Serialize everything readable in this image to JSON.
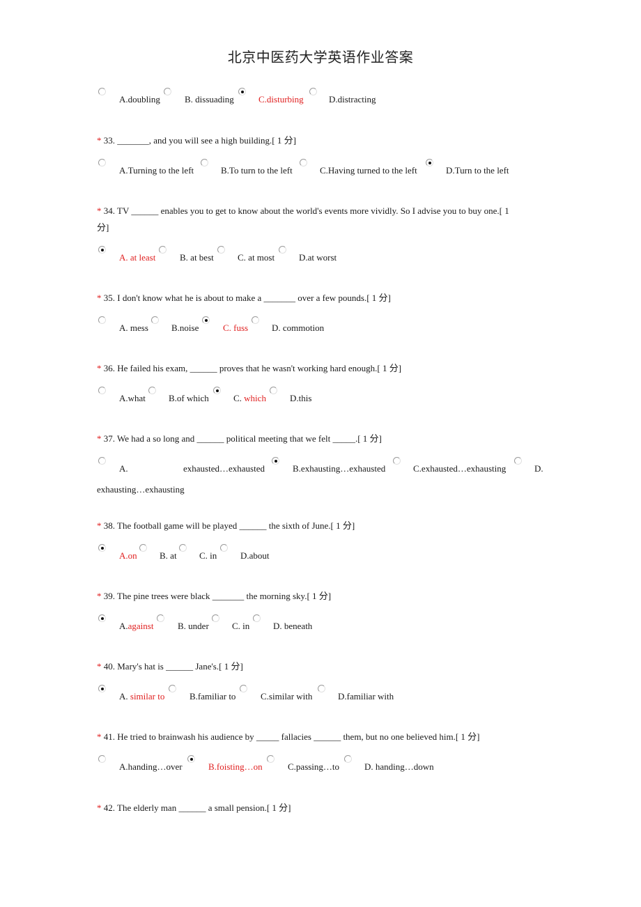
{
  "title": "北京中医药大学英语作业答案",
  "colors": {
    "accent_red": "#e02020",
    "text": "#1a1a1a"
  },
  "questions": [
    {
      "id": "32",
      "prompt": "",
      "options": [
        {
          "prefix": "A.doubling",
          "answer": "",
          "selected": false
        },
        {
          "prefix": "B. dissuading",
          "answer": "",
          "selected": false
        },
        {
          "prefix": "",
          "answer": "C.disturbing",
          "selected": true
        },
        {
          "prefix": "D.distracting",
          "answer": "",
          "selected": false
        }
      ]
    },
    {
      "id": "33",
      "prompt": "33. _______, and you will see a high building.[ 1 分]",
      "options": [
        {
          "prefix": "A.Turning to the left",
          "selected": false
        },
        {
          "prefix": "B.To turn to the left",
          "selected": false
        },
        {
          "prefix": "C.Having turned to the left",
          "selected": false
        },
        {
          "prefix": "D.Turn to the left",
          "selected": true
        }
      ]
    },
    {
      "id": "34",
      "prompt": "34. TV ______ enables you to get to know about the world's events more vividly. So I advise you to buy one.[ 1",
      "prompt_cont": "分]",
      "options": [
        {
          "answer": "A. at least",
          "selected": true
        },
        {
          "prefix": "B. at best",
          "selected": false
        },
        {
          "prefix": "C. at most",
          "selected": false
        },
        {
          "prefix": "D.at worst",
          "selected": false
        }
      ]
    },
    {
      "id": "35",
      "prompt": "35. I don't know what he is about to make a _______ over a few pounds.[ 1 分]",
      "options": [
        {
          "prefix": "A. mess",
          "selected": false
        },
        {
          "prefix": "B.noise",
          "selected": false
        },
        {
          "answer": "C. fuss",
          "selected": true
        },
        {
          "prefix": "D. commotion",
          "selected": false
        }
      ]
    },
    {
      "id": "36",
      "prompt": "36. He failed his exam, ______ proves that he wasn't working hard enough.[ 1 分]",
      "options": [
        {
          "prefix": "A.what",
          "selected": false
        },
        {
          "prefix": "B.of which",
          "selected": false
        },
        {
          "prefix": "C. ",
          "answer": "which",
          "selected": true
        },
        {
          "prefix": "D.this",
          "selected": false
        }
      ]
    },
    {
      "id": "37",
      "prompt": "37. We had a so long and ______ political meeting that we felt _____.[ 1 分]",
      "options": [
        {
          "prefix": "A.",
          "rest": "exhausted…exhausted",
          "selected": false
        },
        {
          "prefix": "B.exhausting…exhausted",
          "selected": true
        },
        {
          "prefix": "C.exhausted…exhausting",
          "selected": false
        },
        {
          "prefix": "D.",
          "rest": "exhausting…exhausting",
          "selected": false
        }
      ]
    },
    {
      "id": "38",
      "prompt": "38. The football game will be played ______ the sixth of June.[ 1 分]",
      "options": [
        {
          "answer": "A.on",
          "selected": true
        },
        {
          "prefix": "B. at",
          "selected": false
        },
        {
          "prefix": "C. in",
          "selected": false
        },
        {
          "prefix": "D.about",
          "selected": false
        }
      ]
    },
    {
      "id": "39",
      "prompt": "39. The pine trees were black _______ the morning sky.[ 1 分]",
      "options": [
        {
          "prefix": "A.",
          "answer": "against",
          "selected": true
        },
        {
          "prefix": "B. under",
          "selected": false
        },
        {
          "prefix": "C. in",
          "selected": false
        },
        {
          "prefix": "D. beneath",
          "selected": false
        }
      ]
    },
    {
      "id": "40",
      "prompt": "40. Mary's hat is ______ Jane's.[ 1 分]",
      "options": [
        {
          "prefix": "A. ",
          "answer": "similar to",
          "selected": true
        },
        {
          "prefix": "B.familiar to",
          "selected": false
        },
        {
          "prefix": "C.similar with",
          "selected": false
        },
        {
          "prefix": "D.familiar with",
          "selected": false
        }
      ]
    },
    {
      "id": "41",
      "prompt": "41. He tried to brainwash his audience by _____ fallacies ______ them, but no one believed him.[ 1 分]",
      "options": [
        {
          "prefix": "A.handing…over",
          "selected": false
        },
        {
          "answer": "B.foisting…on",
          "selected": true
        },
        {
          "prefix": "C.passing…to",
          "selected": false
        },
        {
          "prefix": "D. handing…down",
          "selected": false
        }
      ]
    },
    {
      "id": "42",
      "prompt": "42. The elderly man ______ a small pension.[ 1 分]"
    }
  ],
  "star": "*"
}
